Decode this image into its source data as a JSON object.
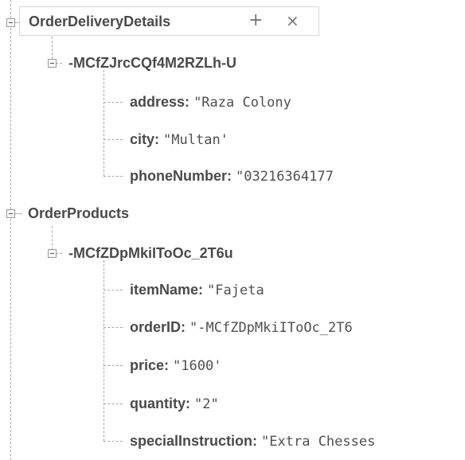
{
  "tree": {
    "delivery": {
      "title": "OrderDeliveryDetails",
      "add_glyph": "+",
      "close_glyph": "×",
      "child_key": "-MCfZJrcCQf4M2RZLh-U",
      "fields": {
        "address": {
          "key": "address:",
          "value": "\"Raza Colony"
        },
        "city": {
          "key": "city:",
          "value": "\"Multan'"
        },
        "phone": {
          "key": "phoneNumber:",
          "value": "\"03216364177"
        }
      }
    },
    "products": {
      "title": "OrderProducts",
      "child_key": "-MCfZDpMkiIToOc_2T6u",
      "fields": {
        "item_name": {
          "key": "itemName:",
          "value": "\"Fajeta"
        },
        "order_id": {
          "key": "orderID:",
          "value": "\"-MCfZDpMkiIToOc_2T6"
        },
        "price": {
          "key": "price:",
          "value": "\"1600'"
        },
        "quantity": {
          "key": "quantity:",
          "value": "\"2\""
        },
        "special": {
          "key": "specialInstruction:",
          "value": "\"Extra Chesses"
        }
      }
    }
  }
}
